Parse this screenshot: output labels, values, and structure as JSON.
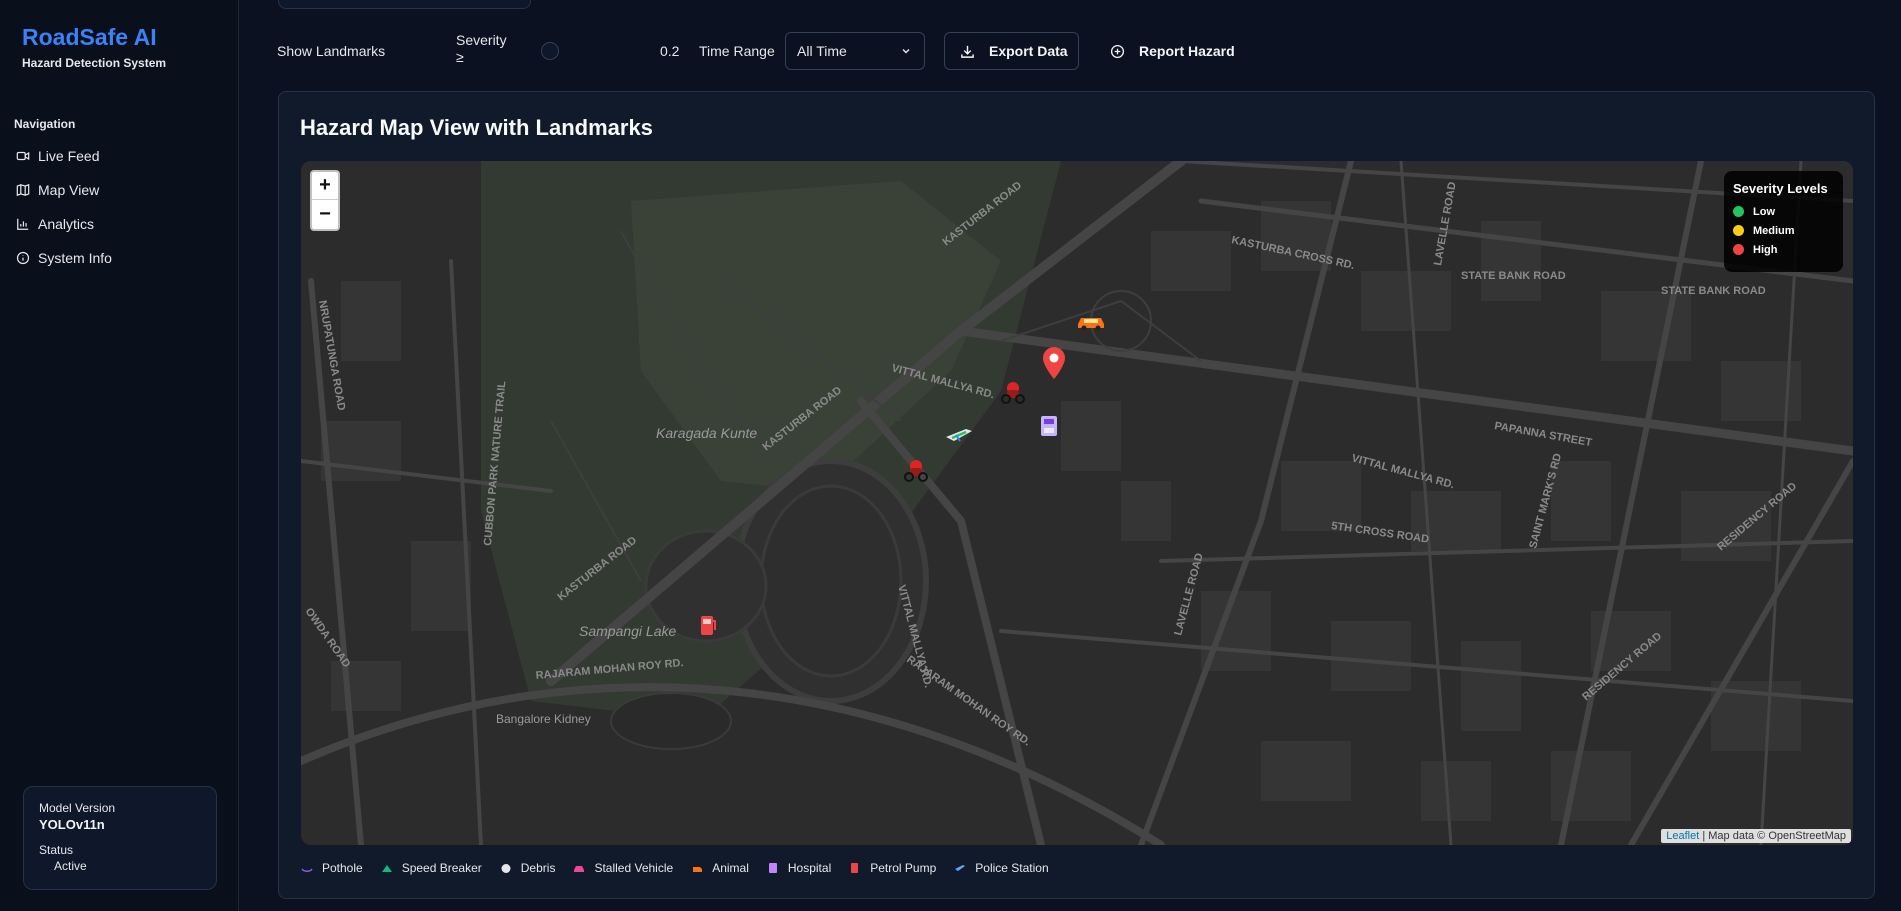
{
  "brand": {
    "title": "RoadSafe AI",
    "subtitle": "Hazard Detection System"
  },
  "sidebar": {
    "heading": "Navigation",
    "items": [
      {
        "label": "Live Feed",
        "icon": "video-icon"
      },
      {
        "label": "Map View",
        "icon": "map-icon"
      },
      {
        "label": "Analytics",
        "icon": "bar-chart-icon"
      },
      {
        "label": "System Info",
        "icon": "info-icon"
      }
    ],
    "model": {
      "version_label": "Model Version",
      "version": "YOLOv11n",
      "status_label": "Status",
      "status": "Active"
    }
  },
  "controls": {
    "landmarks_label": "Show Landmarks",
    "severity_label": "Severity ≥",
    "severity_value": "0.2",
    "time_range_label": "Time Range",
    "time_range_value": "All Time",
    "export_label": "Export Data",
    "report_label": "Report Hazard"
  },
  "map": {
    "title": "Hazard Map View with Landmarks",
    "zoom_in": "+",
    "zoom_out": "−",
    "place_labels": {
      "karagada_kunte": "Karagada Kunte",
      "sampangi_lake": "Sampangi Lake",
      "bangalore_kidney": "Bangalore Kidney",
      "kasturba_road_1": "KASTURBA ROAD",
      "kasturba_road_2": "KASTURBA ROAD",
      "kasturba_road_3": "KASTURBA ROAD",
      "kasturba_cross": "KASTURBA CROSS RD.",
      "vittal_mallya_1": "VITTAL MALLYA RD.",
      "vittal_mallya_2": "VITTAL MALLYA RD.",
      "vittal_mallya_3": "VITTAL MALLYA RD.",
      "lavelle_1": "LAVELLE ROAD",
      "lavelle_2": "LAVELLE ROAD",
      "state_bank_1": "STATE BANK ROAD",
      "state_bank_2": "STATE BANK ROAD",
      "papanna": "PAPANNA STREET",
      "residency_1": "RESIDENCY ROAD",
      "residency_2": "RESIDENCY ROAD",
      "saint_marks": "SAINT MARK'S RD",
      "fifth_cross": "5TH CROSS ROAD",
      "rajaram_1": "RAJARAM MOHAN ROY RD.",
      "rajaram_2": "RAJARAM MOHAN ROY RD.",
      "cubbon_trail": "CUBBON PARK NATURE TRAIL",
      "nrupatunga": "NRUPATUNGA ROAD",
      "owda": "OWDA ROAD"
    },
    "severity_legend": {
      "title": "Severity Levels",
      "levels": [
        {
          "label": "Low",
          "color": "#22c55e"
        },
        {
          "label": "Medium",
          "color": "#facc15"
        },
        {
          "label": "High",
          "color": "#ef4444"
        }
      ]
    },
    "attribution": {
      "leaflet": "Leaflet",
      "rest": "| Map data © OpenStreetMap"
    },
    "markers": [
      {
        "name": "stalled-vehicle-marker",
        "icon": "car-icon"
      },
      {
        "name": "hazard-location-pin",
        "icon": "map-pin-icon"
      },
      {
        "name": "animal-marker",
        "icon": "animal-icon"
      },
      {
        "name": "hospital-marker",
        "icon": "hospital-icon"
      },
      {
        "name": "police-station-marker",
        "icon": "police-icon"
      },
      {
        "name": "animal-marker-2",
        "icon": "animal-icon"
      },
      {
        "name": "petrol-pump-marker",
        "icon": "fuel-icon"
      }
    ]
  },
  "hazard_types": [
    {
      "label": "Pothole",
      "icon": "pothole-icon",
      "color": "#8b5cf6"
    },
    {
      "label": "Speed Breaker",
      "icon": "speed-breaker-icon",
      "color": "#10b981"
    },
    {
      "label": "Debris",
      "icon": "debris-icon",
      "color": "#e5e7eb"
    },
    {
      "label": "Stalled Vehicle",
      "icon": "stalled-vehicle-icon",
      "color": "#ec4899"
    },
    {
      "label": "Animal",
      "icon": "animal-icon",
      "color": "#f97316"
    },
    {
      "label": "Hospital",
      "icon": "hospital-icon",
      "color": "#c084fc"
    },
    {
      "label": "Petrol Pump",
      "icon": "fuel-icon",
      "color": "#ef4444"
    },
    {
      "label": "Police Station",
      "icon": "police-icon",
      "color": "#60a5fa"
    }
  ],
  "colors": {
    "accent": "#3b82f6",
    "background": "#0b1120",
    "card": "#111a2b",
    "map_bg": "#2a2a2a"
  }
}
